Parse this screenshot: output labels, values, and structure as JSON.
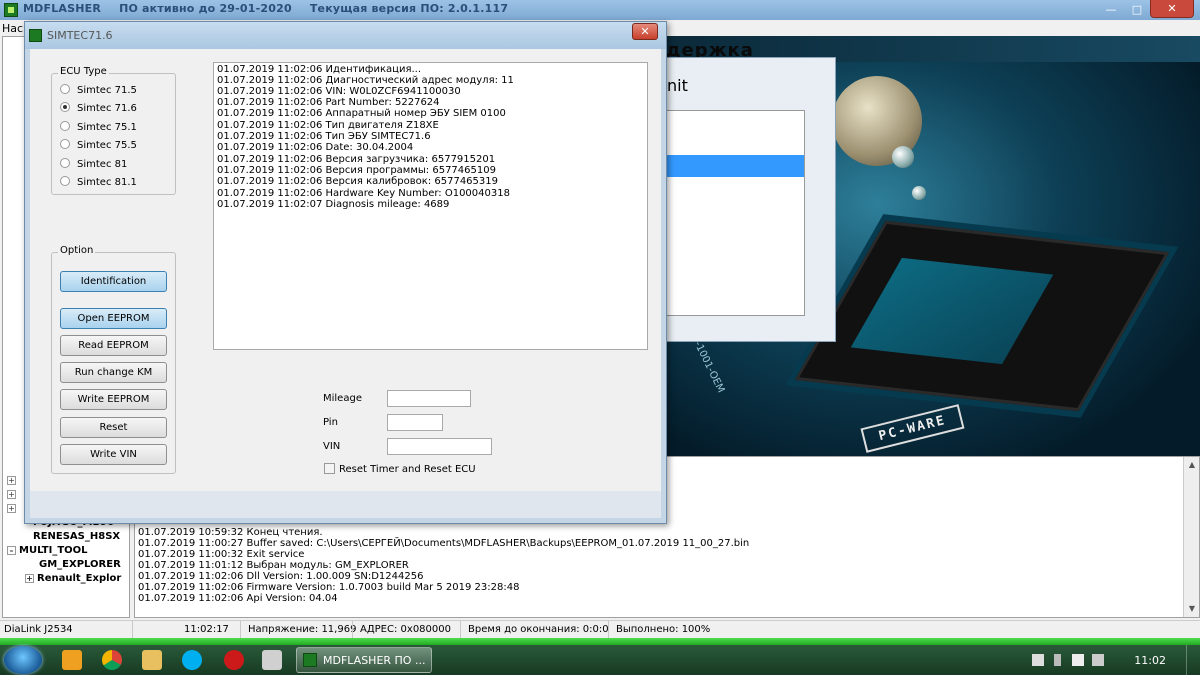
{
  "app": {
    "title_name": "MDFLASHER",
    "title_status": "ПО активно до 29-01-2020",
    "title_version": "Текущая версия ПО: 2.0.1.117",
    "menu_first": "Нас"
  },
  "tree": {
    "items": [
      {
        "label": "FUJITSU_MB96",
        "bold": true
      },
      {
        "label": "RENESAS_H8SX",
        "bold": true
      },
      {
        "label": "MULTI_TOOL",
        "bold": true
      },
      {
        "label": "GM_EXPLORER",
        "bold": true
      },
      {
        "label": "Renault_Explor",
        "bold": true
      }
    ]
  },
  "module_dialog": {
    "heading_fragment": "nit"
  },
  "background_image": {
    "banner_fragment": "держка",
    "label": "PC-WARE",
    "oem_text": "00-1001-OEM"
  },
  "dialog": {
    "title": "SIMTEC71.6",
    "ecu_group_title": "ECU Type",
    "ecu_types": [
      {
        "label": "Simtec 71.5",
        "selected": false
      },
      {
        "label": "Simtec 71.6",
        "selected": true
      },
      {
        "label": "Simtec 75.1",
        "selected": false
      },
      {
        "label": "Simtec 75.5",
        "selected": false
      },
      {
        "label": "Simtec 81",
        "selected": false
      },
      {
        "label": "Simtec 81.1",
        "selected": false
      }
    ],
    "option_group_title": "Option",
    "buttons": {
      "identification": "Identification",
      "open_eeprom": "Open EEPROM",
      "read_eeprom": "Read EEPROM",
      "run_change_km": "Run change KM",
      "write_eeprom": "Write EEPROM",
      "reset": "Reset",
      "write_vin": "Write VIN"
    },
    "log": [
      "01.07.2019 11:02:06  Идентификация...",
      "01.07.2019 11:02:06  Диагностический адрес модуля: 11",
      "01.07.2019 11:02:06  VIN: W0L0ZCF6941100030",
      "01.07.2019 11:02:06  Part Number:  5227624",
      "01.07.2019 11:02:06  Аппаратный номер ЭБУ SIEM 0100",
      "01.07.2019 11:02:06  Тип двигателя  Z18XE",
      "01.07.2019 11:02:06  Тип ЭБУ  SIMTEC71.6",
      "01.07.2019 11:02:06  Date:  30.04.2004",
      "01.07.2019 11:02:06  Версия загрузчика:  6577915201",
      "01.07.2019 11:02:06  Версия программы:  6577465109",
      "01.07.2019 11:02:06  Версия калибровок:  6577465319",
      "01.07.2019 11:02:06  Hardware Key Number: O100040318",
      "01.07.2019 11:02:07  Diagnosis mileage:  4689"
    ],
    "fields": {
      "mileage_label": "Mileage",
      "mileage_value": "",
      "pin_label": "Pin",
      "pin_value": "",
      "vin_label": "VIN",
      "vin_value": ""
    },
    "reset_timer_label": "Reset Timer and Reset ECU",
    "reset_timer_checked": false
  },
  "main_log": {
    "partial_line_fragment": "n",
    "lines": [
      "01.07.2019 10:59:32   Конец чтения.",
      "01.07.2019 11:00:27   Buffer saved:  C:\\Users\\СЕРГЕЙ\\Documents\\MDFLASHER\\Backups\\EEPROM_01.07.2019 11_00_27.bin",
      "01.07.2019 11:00:32   Exit service",
      "01.07.2019 11:01:12   Выбран модуль:  GM_EXPLORER",
      "01.07.2019 11:02:06   Dll Version:  1.00.009 SN:D1244256",
      "01.07.2019 11:02:06   Firmware Version:  1.0.7003 build Mar  5 2019 23:28:48",
      "01.07.2019 11:02:06   Api Version:  04.04"
    ]
  },
  "status_bar": {
    "adapter": "DiaLink J2534",
    "time": "11:02:17",
    "voltage": "Напряжение: 11,969",
    "address": "АДРЕС: 0x080000",
    "time_left": "Время до окончания: 0:0:0",
    "done": "Выполнено: 100%"
  },
  "taskbar": {
    "task_label": "MDFLASHER       ПО ...",
    "clock": "11:02"
  },
  "colors": {
    "accent": "#3399ff",
    "status_green": "#33cc33",
    "taskbar": "#1f4a2c"
  }
}
